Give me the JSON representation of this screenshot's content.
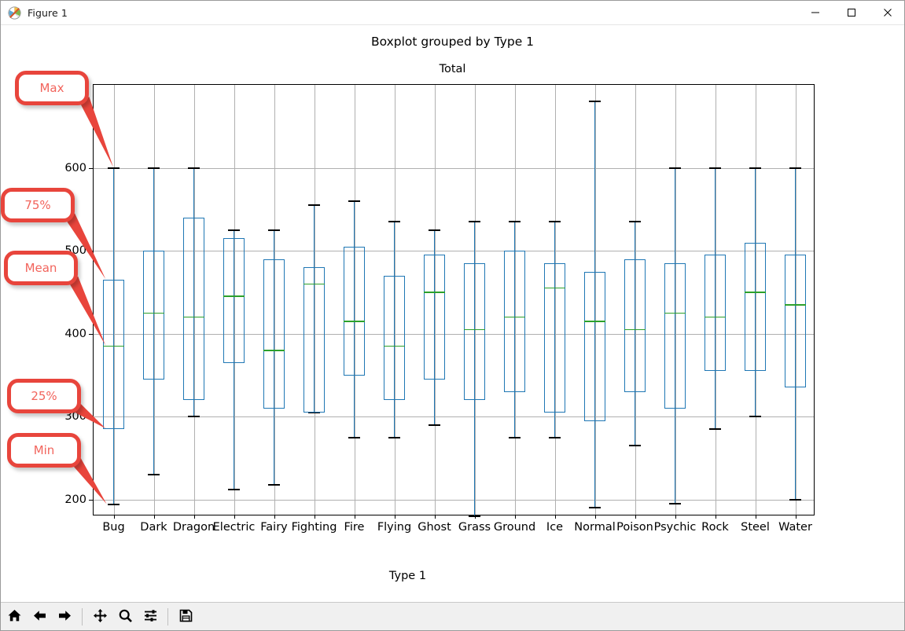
{
  "window": {
    "title": "Figure 1",
    "icon": "matplotlib-icon",
    "minimize_label": "—",
    "maximize_label": "□",
    "close_label": "✕"
  },
  "toolbar": {
    "buttons": [
      {
        "name": "home",
        "label": "Home",
        "icon": "home-icon"
      },
      {
        "name": "back",
        "label": "Back",
        "icon": "left-arrow-icon"
      },
      {
        "name": "forward",
        "label": "Forward",
        "icon": "right-arrow-icon"
      },
      {
        "name": "pan",
        "label": "Pan",
        "icon": "move-icon"
      },
      {
        "name": "zoom",
        "label": "Zoom to rectangle",
        "icon": "magnifier-icon"
      },
      {
        "name": "subplots",
        "label": "Configure subplots",
        "icon": "sliders-icon"
      },
      {
        "name": "save",
        "label": "Save the figure",
        "icon": "floppy-disk-icon"
      }
    ]
  },
  "annotations": [
    {
      "id": "max",
      "label": "Max",
      "target": "upper-whisker-cap"
    },
    {
      "id": "p75",
      "label": "75%",
      "target": "box-top-edge"
    },
    {
      "id": "mean",
      "label": "Mean",
      "target": "median-line"
    },
    {
      "id": "p25",
      "label": "25%",
      "target": "box-bottom-edge"
    },
    {
      "id": "min",
      "label": "Min",
      "target": "lower-whisker-cap"
    }
  ],
  "colors": {
    "box": "#1f77b4",
    "median": "#2ca02c",
    "cap": "#000000",
    "grid": "#b0b0b0",
    "callout_border": "#e8453c",
    "callout_text": "#f2645c"
  },
  "chart_data": {
    "type": "box",
    "title": "Boxplot grouped by Type 1",
    "subtitle": "Total",
    "xlabel": "Type 1",
    "ylabel": "",
    "grid": true,
    "legend": "none",
    "ylim": [
      180,
      700
    ],
    "yticks": [
      200,
      300,
      400,
      500,
      600
    ],
    "ytick_labels": [
      "200",
      "300",
      "400",
      "500",
      "600"
    ],
    "categories": [
      "Bug",
      "Dark",
      "Dragon",
      "Electric",
      "Fairy",
      "Fighting",
      "Fire",
      "Flying",
      "Ghost",
      "Grass",
      "Ground",
      "Ice",
      "Normal",
      "Poison",
      "Psychic",
      "Rock",
      "Steel",
      "Water"
    ],
    "boxes": [
      {
        "category": "Bug",
        "min": 194,
        "q1": 285,
        "median": 385,
        "q3": 465,
        "max": 600
      },
      {
        "category": "Dark",
        "min": 230,
        "q1": 345,
        "median": 425,
        "q3": 500,
        "max": 600
      },
      {
        "category": "Dragon",
        "min": 300,
        "q1": 320,
        "median": 420,
        "q3": 540,
        "max": 600
      },
      {
        "category": "Electric",
        "min": 212,
        "q1": 365,
        "median": 445,
        "q3": 515,
        "max": 525
      },
      {
        "category": "Fairy",
        "min": 218,
        "q1": 310,
        "median": 380,
        "q3": 490,
        "max": 525
      },
      {
        "category": "Fighting",
        "min": 305,
        "q1": 305,
        "median": 460,
        "q3": 480,
        "max": 555
      },
      {
        "category": "Fire",
        "min": 275,
        "q1": 350,
        "median": 415,
        "q3": 505,
        "max": 560
      },
      {
        "category": "Flying",
        "min": 275,
        "q1": 320,
        "median": 385,
        "q3": 470,
        "max": 535
      },
      {
        "category": "Ghost",
        "min": 290,
        "q1": 345,
        "median": 450,
        "q3": 495,
        "max": 525
      },
      {
        "category": "Grass",
        "min": 180,
        "q1": 320,
        "median": 405,
        "q3": 485,
        "max": 535
      },
      {
        "category": "Ground",
        "min": 275,
        "q1": 330,
        "median": 420,
        "q3": 500,
        "max": 535
      },
      {
        "category": "Ice",
        "min": 275,
        "q1": 305,
        "median": 455,
        "q3": 485,
        "max": 535
      },
      {
        "category": "Normal",
        "min": 190,
        "q1": 295,
        "median": 415,
        "q3": 475,
        "max": 680
      },
      {
        "category": "Poison",
        "min": 265,
        "q1": 330,
        "median": 405,
        "q3": 490,
        "max": 535
      },
      {
        "category": "Psychic",
        "min": 195,
        "q1": 310,
        "median": 425,
        "q3": 485,
        "max": 600
      },
      {
        "category": "Rock",
        "min": 285,
        "q1": 355,
        "median": 420,
        "q3": 495,
        "max": 600
      },
      {
        "category": "Steel",
        "min": 300,
        "q1": 355,
        "median": 450,
        "q3": 510,
        "max": 600
      },
      {
        "category": "Water",
        "min": 200,
        "q1": 335,
        "median": 435,
        "q3": 495,
        "max": 600
      }
    ]
  }
}
